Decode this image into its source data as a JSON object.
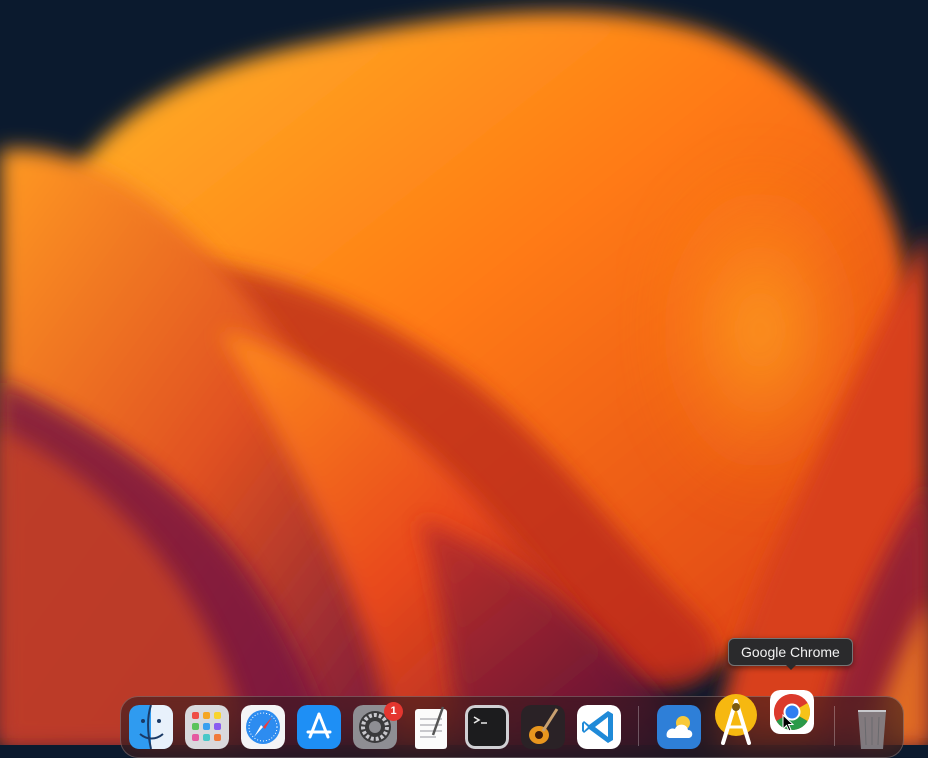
{
  "tooltip": {
    "text": "Google Chrome"
  },
  "dock": {
    "apps": [
      {
        "id": "finder",
        "icon": "finder-icon"
      },
      {
        "id": "launchpad",
        "icon": "launchpad-icon"
      },
      {
        "id": "safari",
        "icon": "safari-icon"
      },
      {
        "id": "app-store",
        "icon": "app-store-icon"
      },
      {
        "id": "system-preferences",
        "icon": "system-preferences-icon",
        "badge": "1"
      },
      {
        "id": "textedit",
        "icon": "textedit-icon"
      },
      {
        "id": "terminal",
        "icon": "terminal-icon"
      },
      {
        "id": "garageband",
        "icon": "garageband-icon"
      },
      {
        "id": "vscode",
        "icon": "vscode-icon"
      },
      {
        "id": "weather",
        "icon": "weather-icon"
      },
      {
        "id": "android-studio",
        "icon": "android-studio-icon"
      },
      {
        "id": "google-chrome",
        "icon": "chrome-icon",
        "hovered": true
      },
      {
        "id": "trash",
        "icon": "trash-icon"
      }
    ]
  },
  "colors": {
    "wallpaper_orange": "#ff8a1c",
    "wallpaper_red": "#d8331a",
    "wallpaper_purple": "#6a1140",
    "wallpaper_navy": "#0b1a2e",
    "badge_red": "#e5362f"
  }
}
